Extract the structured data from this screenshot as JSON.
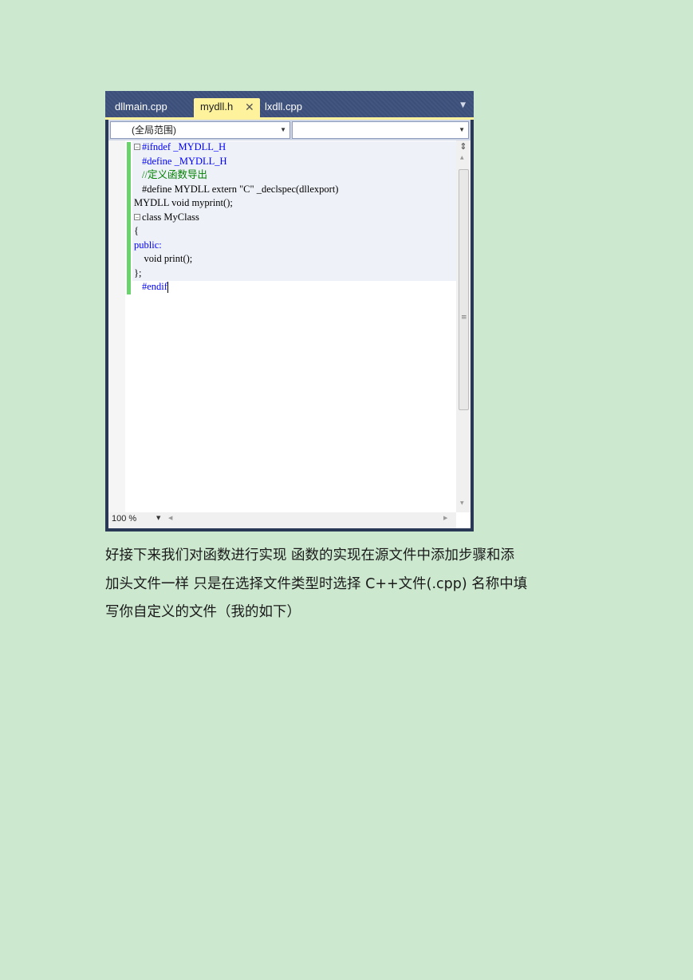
{
  "ide": {
    "tabs": [
      {
        "label": "dllmain.cpp",
        "active": false
      },
      {
        "label": "mydll.h",
        "active": true
      },
      {
        "label": "lxdll.cpp",
        "active": false
      }
    ],
    "tab_menu_icon": "chevron-down-icon",
    "close_icon": "close-icon",
    "nav": {
      "scope": "(全局范围)",
      "member": ""
    },
    "code_lines": [
      "#ifndef _MYDLL_H",
      "#define _MYDLL_H",
      "//定义函数导出",
      "#define MYDLL extern \"C\" _declspec(dllexport)",
      "MYDLL void myprint();",
      "class MyClass",
      "{",
      "public:",
      "    void print();",
      "};",
      "#endif"
    ],
    "status": {
      "zoom": "100 %"
    },
    "colors": {
      "tabbar": "#3b4f7a",
      "active_tab": "#fff29d",
      "change_bar": "#6bd36b",
      "keyword": "#0000ff",
      "comment": "#008000",
      "string": "#a31515"
    }
  },
  "paragraph": {
    "lines": [
      "好接下来我们对函数进行实现 函数的实现在源文件中添加步骤和添",
      "加头文件一样 只是在选择文件类型时选择 C++文件(.cpp) 名称中填",
      "写你自定义的文件（我的如下）"
    ]
  }
}
